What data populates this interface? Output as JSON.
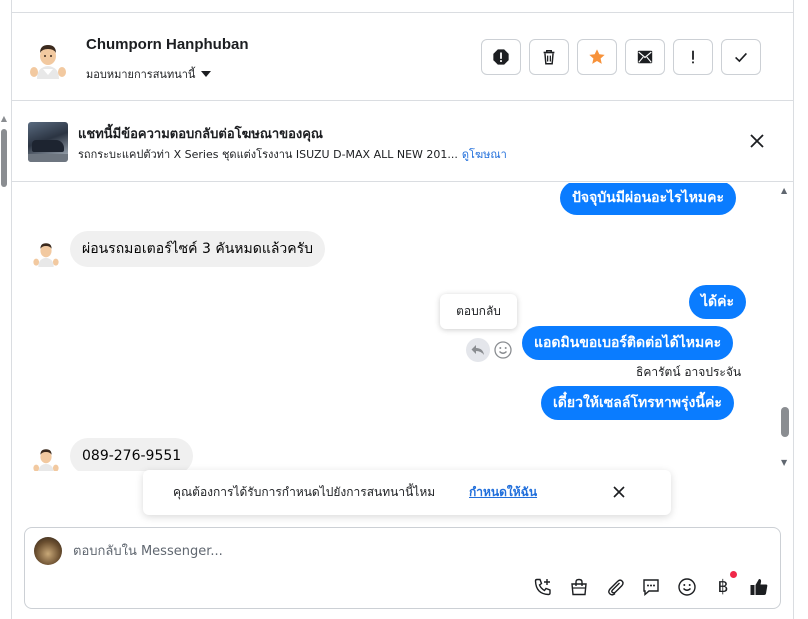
{
  "header": {
    "contact_name": "Chumporn Hanphuban",
    "assign_label": "มอบหมายการสนทนานี้"
  },
  "ad_banner": {
    "title": "แชทนี้มีข้อความตอบกลับต่อโฆษณาของคุณ",
    "description": "รถกระบะแคปตัวท่า X Series ชุดแต่งโรงงาน ISUZU D-MAX ALL NEW 201...",
    "link": "ดูโฆษณา"
  },
  "messages": [
    {
      "direction": "out",
      "text": "ปัจจุบันมีผ่อนอะไรไหมคะ"
    },
    {
      "direction": "in",
      "text": "ผ่อนรถมอเตอร์ไซค์ 3 คันหมดแล้วครับ"
    },
    {
      "direction": "out",
      "text": "ได้ค่ะ"
    },
    {
      "direction": "out",
      "text": "แอดมินขอเบอร์ติดต่อได้ไหมคะ"
    },
    {
      "direction": "out",
      "text": "เดี๋ยวให้เซลล์โทรหาพรุ่งนี้ค่ะ"
    },
    {
      "direction": "in",
      "text": "089-276-9551"
    }
  ],
  "tooltip": "ตอบกลับ",
  "sender_name": "ธิคารัตน์ อาจประจัน",
  "toast": {
    "text": "คุณต้องการได้รับการกำหนดไปยังการสนทนานี้ไหม",
    "link": "กำหนดให้ฉัน"
  },
  "composer": {
    "placeholder": "ตอบกลับใน Messenger..."
  },
  "colors": {
    "outgoing_bubble": "#0a7cff",
    "incoming_bubble": "#f0f0f0",
    "star": "#f7923a",
    "link": "#216fdb"
  },
  "icons": {
    "header_actions": [
      "spam-alert-icon",
      "trash-icon",
      "star-icon",
      "mark-unread-icon",
      "exclamation-icon",
      "check-icon"
    ],
    "composer_tools": [
      "call-icon",
      "shopping-bag-icon",
      "paperclip-icon",
      "saved-reply-icon",
      "emoji-icon",
      "baht-payment-icon",
      "like-icon"
    ]
  }
}
